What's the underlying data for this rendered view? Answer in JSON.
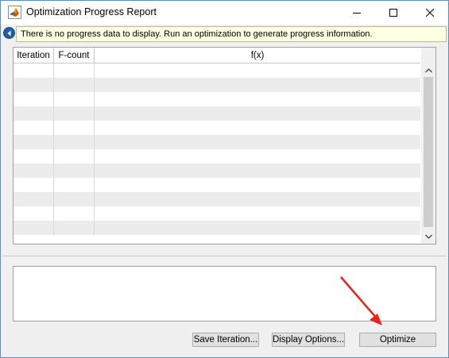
{
  "window": {
    "title": "Optimization Progress Report",
    "border_color": "#5a8fc4"
  },
  "titlebar_controls": {
    "minimize_icon": "minimize-icon",
    "maximize_icon": "maximize-icon",
    "close_icon": "close-icon"
  },
  "infobar": {
    "collapse_icon": "chevron-left-icon",
    "message": "There is no progress data to display. Run an optimization to generate progress information.",
    "message_bg": "#ffffe1"
  },
  "table": {
    "columns": [
      "Iteration",
      "F-count",
      "f(x)"
    ],
    "rows": [
      [
        "",
        "",
        ""
      ],
      [
        "",
        "",
        ""
      ],
      [
        "",
        "",
        ""
      ],
      [
        "",
        "",
        ""
      ],
      [
        "",
        "",
        ""
      ],
      [
        "",
        "",
        ""
      ],
      [
        "",
        "",
        ""
      ],
      [
        "",
        "",
        ""
      ],
      [
        "",
        "",
        ""
      ],
      [
        "",
        "",
        ""
      ],
      [
        "",
        "",
        ""
      ],
      [
        "",
        "",
        ""
      ]
    ]
  },
  "buttons": {
    "save_iteration": "Save Iteration...",
    "display_options": "Display Options...",
    "optimize": "Optimize"
  },
  "annotation": {
    "arrow_color": "#e8231b"
  }
}
